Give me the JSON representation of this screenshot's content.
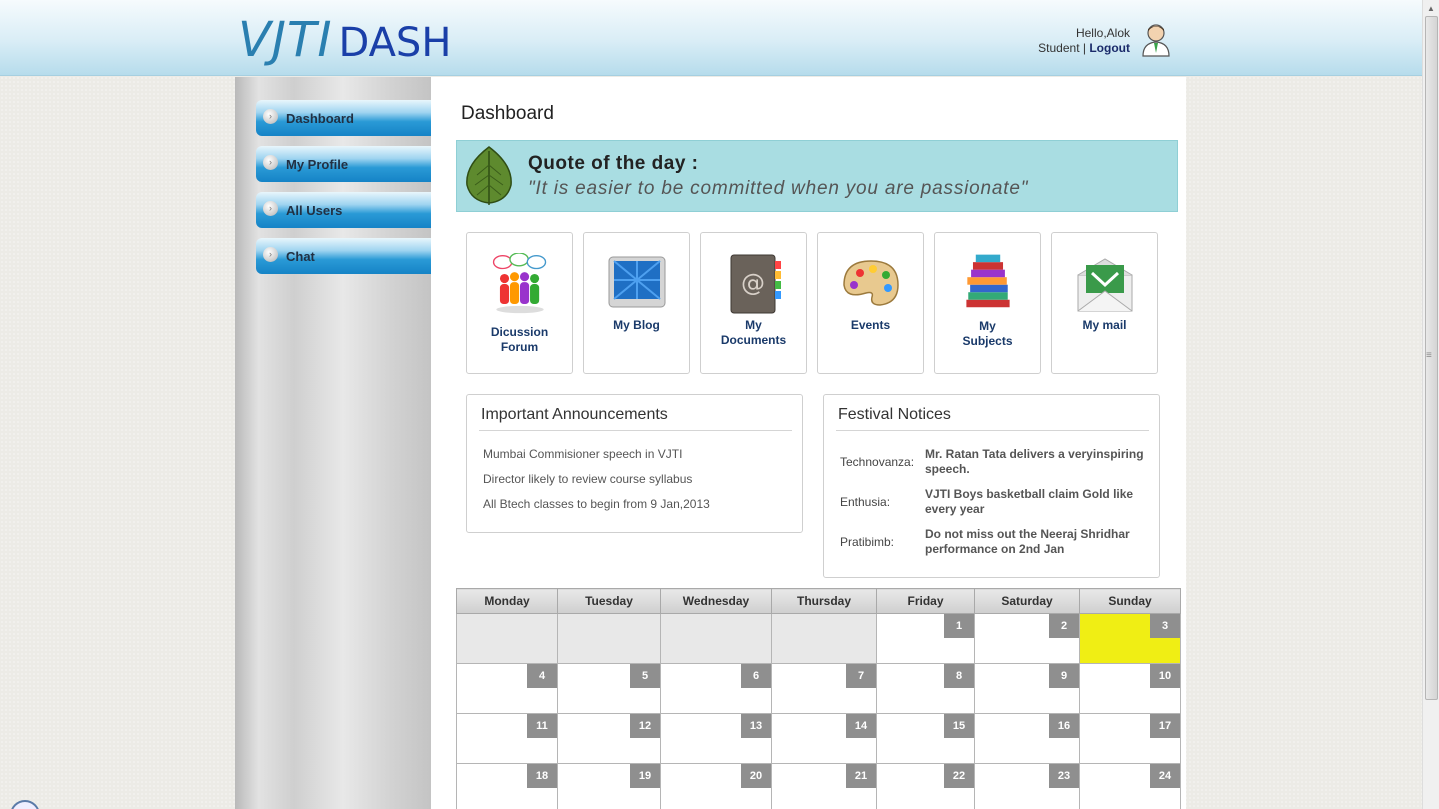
{
  "header": {
    "logo_main": "VJTI",
    "logo_sub": "DASH",
    "greeting": "Hello,Alok",
    "role": "Student",
    "separator": "|",
    "logout": "Logout"
  },
  "sidebar": {
    "items": [
      {
        "label": "Dashboard"
      },
      {
        "label": "My Profile"
      },
      {
        "label": "All Users"
      },
      {
        "label": "Chat"
      }
    ]
  },
  "main": {
    "title": "Dashboard",
    "quote": {
      "heading": "Quote of the day :",
      "text": "\"It is easier to be committed when you are passionate\""
    },
    "tiles": [
      {
        "label": "Dicussion Forum",
        "icon": "discussion-forum-icon"
      },
      {
        "label": "My Blog",
        "icon": "blog-icon"
      },
      {
        "label": "My Documents",
        "icon": "address-book-icon"
      },
      {
        "label": "Events",
        "icon": "palette-icon"
      },
      {
        "label": "My Subjects",
        "icon": "books-icon"
      },
      {
        "label": "My mail",
        "icon": "mail-icon"
      }
    ],
    "announcements": {
      "title": "Important Announcements",
      "items": [
        "Mumbai Commisioner speech in VJTI",
        "Director likely to review course syllabus",
        "All Btech classes to begin from 9 Jan,2013"
      ]
    },
    "festivals": {
      "title": "Festival Notices",
      "items": [
        {
          "name": "Technovanza:",
          "text": "Mr. Ratan Tata delivers a veryinspiring speech."
        },
        {
          "name": "Enthusia:",
          "text": "VJTI Boys basketball claim Gold like every year"
        },
        {
          "name": "Pratibimb:",
          "text": "Do not miss out the Neeraj Shridhar performance on 2nd Jan"
        }
      ]
    },
    "calendar": {
      "days": [
        "Monday",
        "Tuesday",
        "Wednesday",
        "Thursday",
        "Friday",
        "Saturday",
        "Sunday"
      ],
      "weeks": [
        [
          "",
          "",
          "",
          "",
          "1",
          "2",
          "3"
        ],
        [
          "4",
          "5",
          "6",
          "7",
          "8",
          "9",
          "10"
        ],
        [
          "11",
          "12",
          "13",
          "14",
          "15",
          "16",
          "17"
        ],
        [
          "18",
          "19",
          "20",
          "21",
          "22",
          "23",
          "24"
        ]
      ],
      "today": "3",
      "highlight_color": "#f0ee14"
    }
  }
}
